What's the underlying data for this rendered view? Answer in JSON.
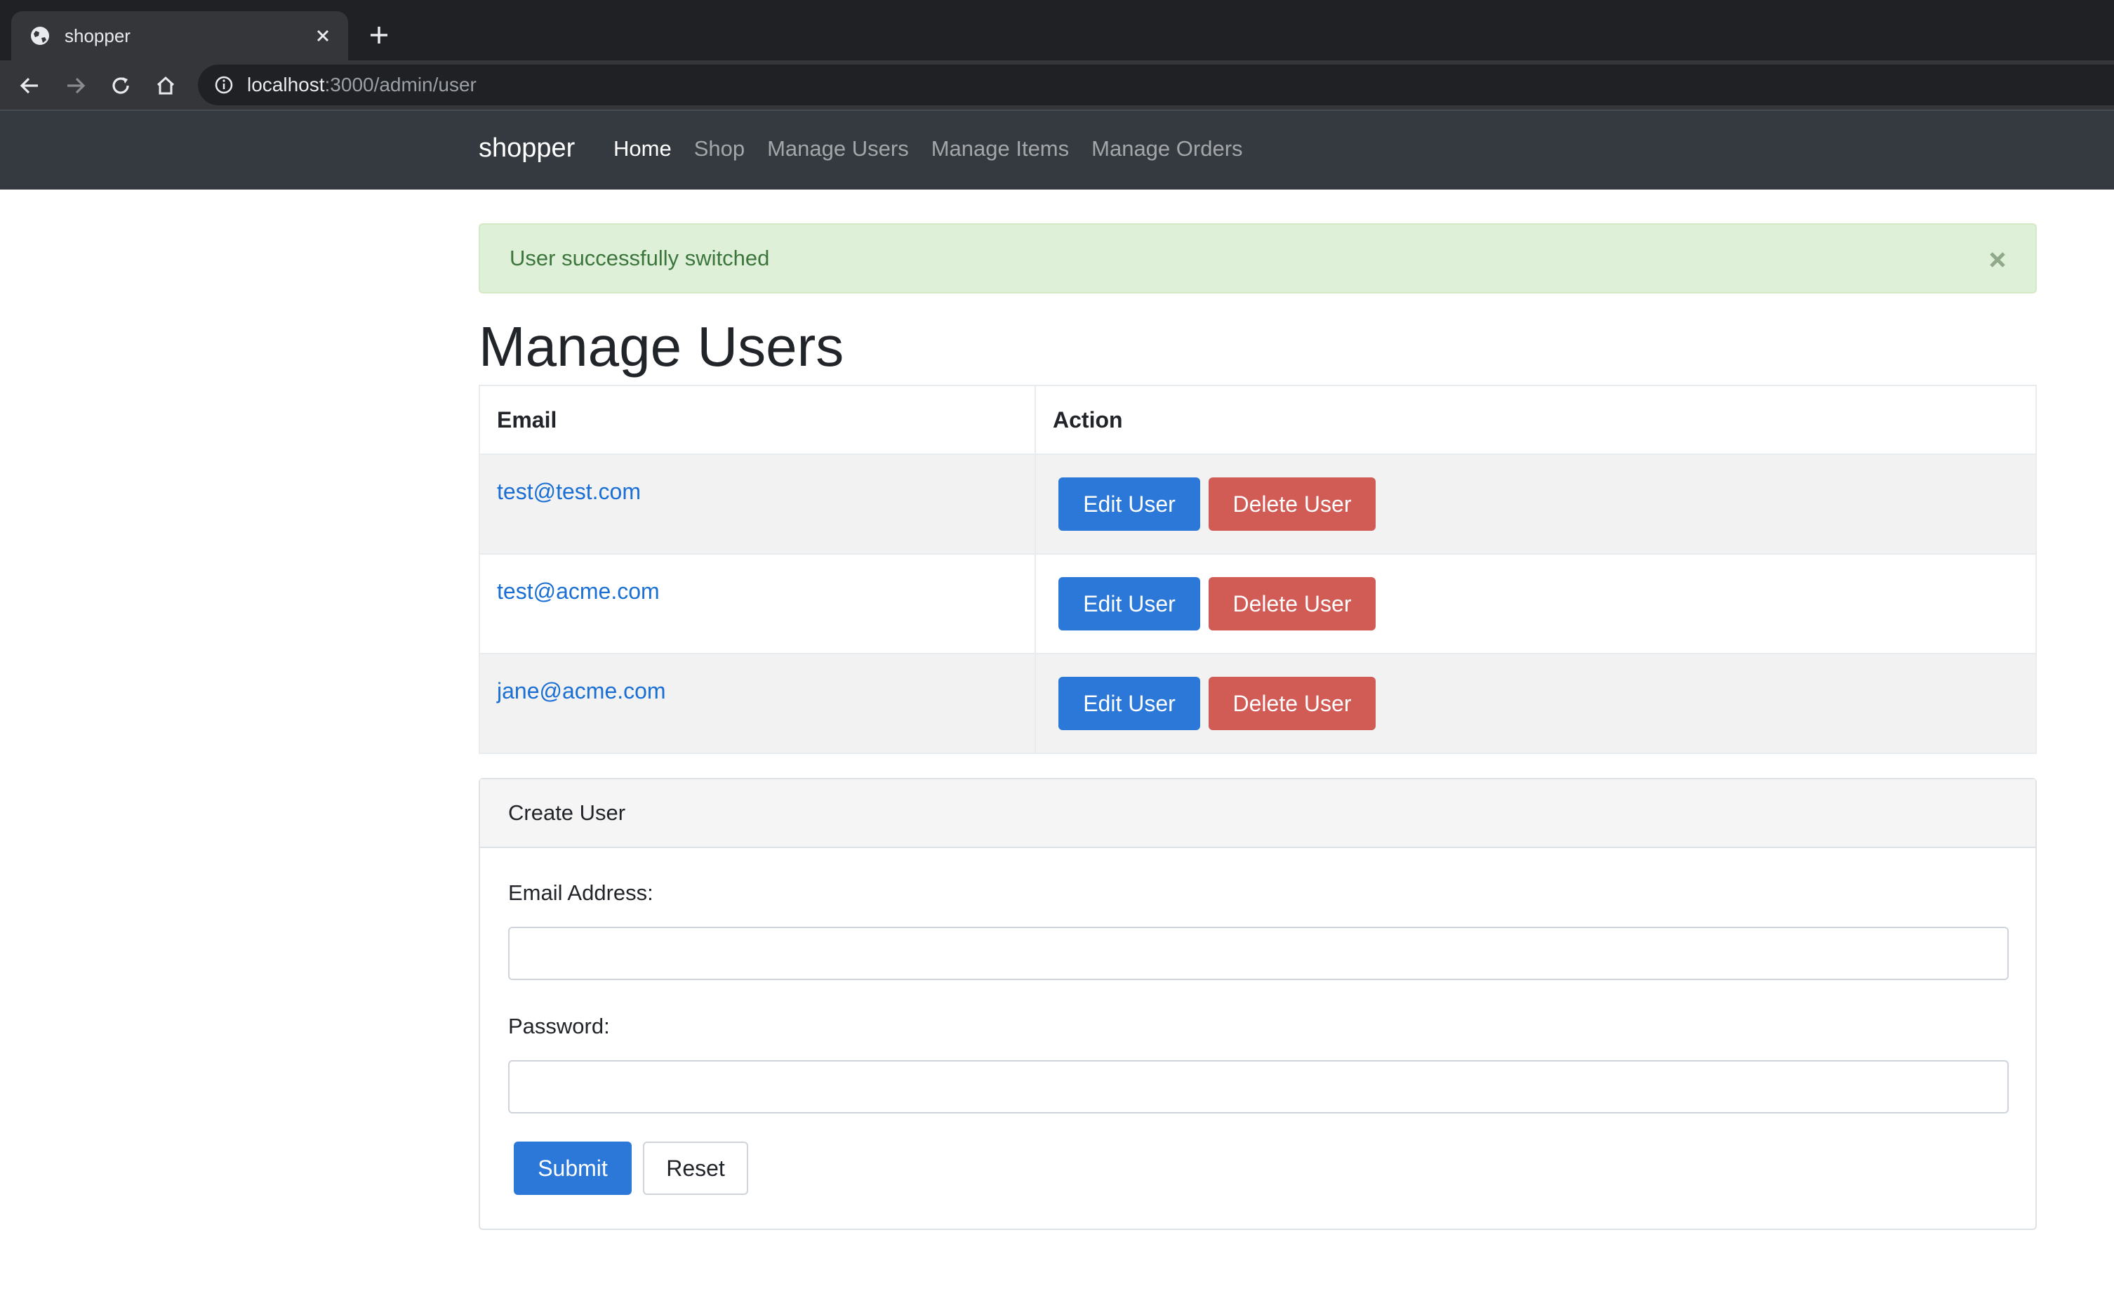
{
  "browser": {
    "tab_title": "shopper",
    "url_host": "localhost",
    "url_rest": ":3000/admin/user"
  },
  "navbar": {
    "brand": "shopper",
    "links": [
      {
        "label": "Home",
        "active": true
      },
      {
        "label": "Shop",
        "active": false
      },
      {
        "label": "Manage Users",
        "active": false
      },
      {
        "label": "Manage Items",
        "active": false
      },
      {
        "label": "Manage Orders",
        "active": false
      }
    ]
  },
  "alert": {
    "message": "User successfully switched"
  },
  "page": {
    "title": "Manage Users"
  },
  "users_table": {
    "headers": [
      "Email",
      "Action"
    ],
    "rows": [
      {
        "email": "test@test.com",
        "edit_label": "Edit User",
        "delete_label": "Delete User"
      },
      {
        "email": "test@acme.com",
        "edit_label": "Edit User",
        "delete_label": "Delete User"
      },
      {
        "email": "jane@acme.com",
        "edit_label": "Edit User",
        "delete_label": "Delete User"
      }
    ]
  },
  "create_user": {
    "header": "Create User",
    "email_label": "Email Address:",
    "email_value": "",
    "password_label": "Password:",
    "password_value": "",
    "submit_label": "Submit",
    "reset_label": "Reset"
  },
  "colors": {
    "primary": "#2b78d9",
    "danger": "#d15b55",
    "alert_bg": "#dff0d8",
    "alert_text": "#3c763d",
    "navbar_bg": "#343a40"
  }
}
